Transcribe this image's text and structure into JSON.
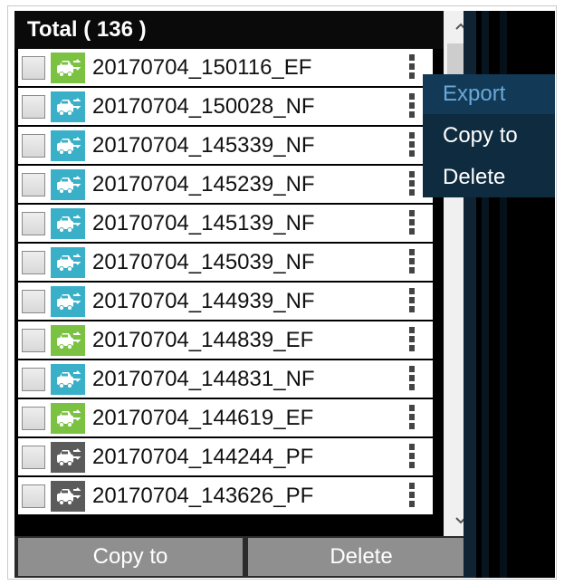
{
  "header": {
    "title": "Total ( 136 )"
  },
  "files": [
    {
      "name": "20170704_150116_EF",
      "type": "EF"
    },
    {
      "name": "20170704_150028_NF",
      "type": "NF"
    },
    {
      "name": "20170704_145339_NF",
      "type": "NF"
    },
    {
      "name": "20170704_145239_NF",
      "type": "NF"
    },
    {
      "name": "20170704_145139_NF",
      "type": "NF"
    },
    {
      "name": "20170704_145039_NF",
      "type": "NF"
    },
    {
      "name": "20170704_144939_NF",
      "type": "NF"
    },
    {
      "name": "20170704_144839_EF",
      "type": "EF"
    },
    {
      "name": "20170704_144831_NF",
      "type": "NF"
    },
    {
      "name": "20170704_144619_EF",
      "type": "EF"
    },
    {
      "name": "20170704_144244_PF",
      "type": "PF"
    },
    {
      "name": "20170704_143626_PF",
      "type": "PF"
    }
  ],
  "type_colors": {
    "EF": "#7cc242",
    "NF": "#3ab0c8",
    "PF": "#5b5b5b"
  },
  "icons": {
    "file_type": "car-transfer-icon",
    "row_menu": "kebab-menu-icon",
    "scroll_up": "chevron-up-icon",
    "scroll_down": "chevron-down-icon"
  },
  "context_menu": {
    "items": [
      "Export",
      "Copy to",
      "Delete"
    ],
    "active_index": 0
  },
  "footer": {
    "copy_label": "Copy to",
    "delete_label": "Delete"
  },
  "scroll": {
    "up_glyph": "^",
    "down_glyph": "v"
  }
}
